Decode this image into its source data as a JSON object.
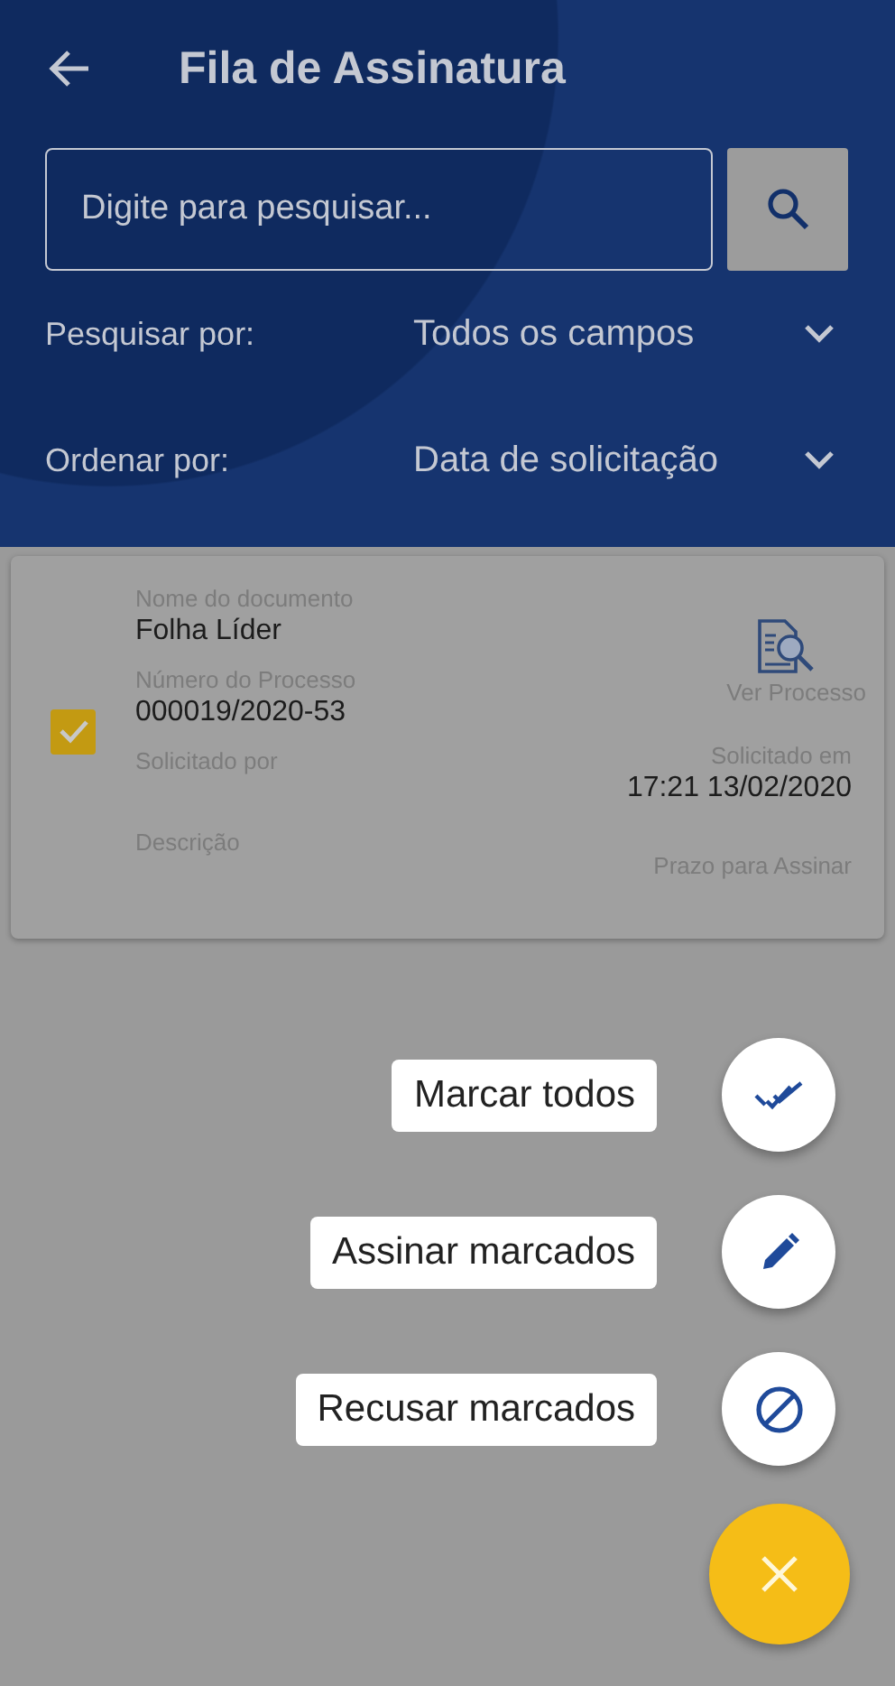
{
  "header": {
    "title": "Fila de Assinatura"
  },
  "search": {
    "placeholder": "Digite para pesquisar..."
  },
  "filters": [
    {
      "label": "Pesquisar por:",
      "value": "Todos os campos"
    },
    {
      "label": "Ordenar por:",
      "value": "Data de solicitação"
    }
  ],
  "documents": [
    {
      "checked": true,
      "name_label": "Nome do documento",
      "name": "Folha Líder",
      "process_label": "Número do Processo",
      "process": "000019/2020-53",
      "requested_by_label": "Solicitado por",
      "description_label": "Descrição",
      "view_link": "Ver Processo",
      "requested_at_label": "Solicitado em",
      "requested_at": "17:21 13/02/2020",
      "deadline_label": "Prazo para Assinar"
    }
  ],
  "fab": {
    "expanded": true,
    "actions": [
      {
        "kind": "check_all",
        "label": "Marcar todos"
      },
      {
        "kind": "sign",
        "label": "Assinar marcados"
      },
      {
        "kind": "refuse",
        "label": "Recusar marcados"
      }
    ]
  }
}
